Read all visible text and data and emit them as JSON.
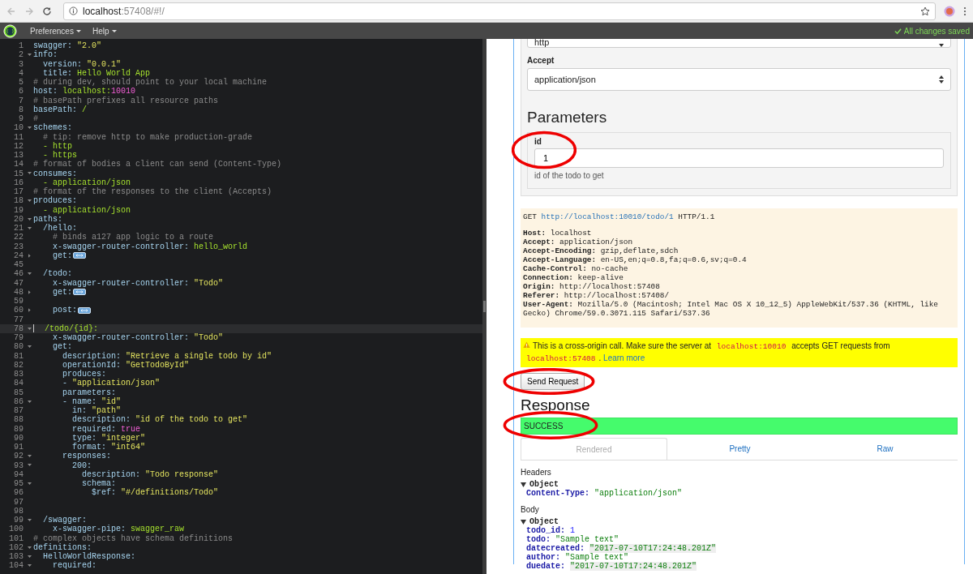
{
  "browser": {
    "url_host": "localhost",
    "url_rest": ":57408/#!/"
  },
  "menubar": {
    "menus": [
      {
        "label": "Preferences"
      },
      {
        "label": "Help"
      }
    ],
    "save_status": "All changes saved"
  },
  "editor": {
    "lines": [
      {
        "number": "1",
        "active": false,
        "segs": [
          {
            "kind": "key",
            "text": "swagger: "
          },
          {
            "kind": "str",
            "text": "\"2.0\""
          }
        ]
      },
      {
        "number": "2",
        "active": false,
        "expanded": true,
        "segs": [
          {
            "kind": "key",
            "text": "info:"
          }
        ]
      },
      {
        "number": "3",
        "active": false,
        "segs": [
          {
            "kind": "key",
            "text": "  version: "
          },
          {
            "kind": "str",
            "text": "\"0.0.1\""
          }
        ]
      },
      {
        "number": "4",
        "active": false,
        "segs": [
          {
            "kind": "key",
            "text": "  title: "
          },
          {
            "kind": "val",
            "text": "Hello World App"
          }
        ]
      },
      {
        "number": "5",
        "active": false,
        "segs": [
          {
            "kind": "comment",
            "text": "# during dev, should point to your local machine"
          }
        ]
      },
      {
        "number": "6",
        "active": false,
        "segs": [
          {
            "kind": "key",
            "text": "host: "
          },
          {
            "kind": "val",
            "text": "localhost:"
          },
          {
            "kind": "const",
            "text": "10010"
          }
        ]
      },
      {
        "number": "7",
        "active": false,
        "segs": [
          {
            "kind": "comment",
            "text": "# basePath prefixes all resource paths"
          }
        ]
      },
      {
        "number": "8",
        "active": false,
        "segs": [
          {
            "kind": "key",
            "text": "basePath: "
          },
          {
            "kind": "val",
            "text": "/"
          }
        ]
      },
      {
        "number": "9",
        "active": false,
        "segs": [
          {
            "kind": "comment",
            "text": "#"
          }
        ]
      },
      {
        "number": "10",
        "active": false,
        "expanded": true,
        "segs": [
          {
            "kind": "key",
            "text": "schemes:"
          }
        ]
      },
      {
        "number": "11",
        "active": false,
        "segs": [
          {
            "kind": "comment",
            "text": "  # tip: remove http to make production-grade"
          }
        ]
      },
      {
        "number": "12",
        "active": false,
        "segs": [
          {
            "kind": "val",
            "text": "  - http"
          }
        ]
      },
      {
        "number": "13",
        "active": false,
        "segs": [
          {
            "kind": "val",
            "text": "  - https"
          }
        ]
      },
      {
        "number": "14",
        "active": false,
        "segs": [
          {
            "kind": "comment",
            "text": "# format of bodies a client can send (Content-Type)"
          }
        ]
      },
      {
        "number": "15",
        "active": false,
        "expanded": true,
        "segs": [
          {
            "kind": "key",
            "text": "consumes:"
          }
        ]
      },
      {
        "number": "16",
        "active": false,
        "segs": [
          {
            "kind": "val",
            "text": "  - application/json"
          }
        ]
      },
      {
        "number": "17",
        "active": false,
        "segs": [
          {
            "kind": "comment",
            "text": "# format of the responses to the client (Accepts)"
          }
        ]
      },
      {
        "number": "18",
        "active": false,
        "expanded": true,
        "segs": [
          {
            "kind": "key",
            "text": "produces:"
          }
        ]
      },
      {
        "number": "19",
        "active": false,
        "segs": [
          {
            "kind": "val",
            "text": "  - application/json"
          }
        ]
      },
      {
        "number": "20",
        "active": false,
        "expanded": true,
        "segs": [
          {
            "kind": "key",
            "text": "paths:"
          }
        ]
      },
      {
        "number": "21",
        "active": false,
        "expanded": true,
        "segs": [
          {
            "kind": "key",
            "text": "  /hello:"
          }
        ]
      },
      {
        "number": "22",
        "active": false,
        "segs": [
          {
            "kind": "comment",
            "text": "    # binds a127 app logic to a route"
          }
        ]
      },
      {
        "number": "23",
        "active": false,
        "segs": [
          {
            "kind": "key",
            "text": "    x-swagger-router-controller: "
          },
          {
            "kind": "val",
            "text": "hello_world"
          }
        ]
      },
      {
        "number": "24",
        "active": false,
        "expanded": false,
        "segs": [
          {
            "kind": "key",
            "text": "    get:"
          }
        ]
      },
      {
        "number": "45",
        "active": false
      },
      {
        "number": "46",
        "active": false,
        "expanded": true,
        "segs": [
          {
            "kind": "key",
            "text": "  /todo:"
          }
        ]
      },
      {
        "number": "47",
        "active": false,
        "segs": [
          {
            "kind": "key",
            "text": "    x-swagger-router-controller: "
          },
          {
            "kind": "str",
            "text": "\"Todo\""
          }
        ]
      },
      {
        "number": "48",
        "active": false,
        "expanded": false,
        "segs": [
          {
            "kind": "key",
            "text": "    get:"
          }
        ]
      },
      {
        "number": "59",
        "active": false
      },
      {
        "number": "60",
        "active": false,
        "expanded": false,
        "segs": [
          {
            "kind": "key",
            "text": "    post:"
          }
        ]
      },
      {
        "number": "77",
        "active": false
      },
      {
        "number": "78",
        "active": true,
        "expanded": true,
        "segs": [
          {
            "kind": "val",
            "text": "  /todo/{id}:"
          }
        ]
      },
      {
        "number": "79",
        "active": false,
        "segs": [
          {
            "kind": "key",
            "text": "    x-swagger-router-controller: "
          },
          {
            "kind": "str",
            "text": "\"Todo\""
          }
        ]
      },
      {
        "number": "80",
        "active": false,
        "expanded": true,
        "segs": [
          {
            "kind": "key",
            "text": "    get:"
          }
        ]
      },
      {
        "number": "81",
        "active": false,
        "segs": [
          {
            "kind": "key",
            "text": "      description: "
          },
          {
            "kind": "str",
            "text": "\"Retrieve a single todo by id\""
          }
        ]
      },
      {
        "number": "82",
        "active": false,
        "segs": [
          {
            "kind": "key",
            "text": "      operationId: "
          },
          {
            "kind": "str",
            "text": "\"GetTodoById\""
          }
        ]
      },
      {
        "number": "83",
        "active": false,
        "segs": [
          {
            "kind": "key",
            "text": "      produces:"
          }
        ]
      },
      {
        "number": "84",
        "active": false,
        "segs": [
          {
            "kind": "key",
            "text": "      - "
          },
          {
            "kind": "str",
            "text": "\"application/json\""
          }
        ]
      },
      {
        "number": "85",
        "active": false,
        "segs": [
          {
            "kind": "key",
            "text": "      parameters:"
          }
        ]
      },
      {
        "number": "86",
        "active": false,
        "expanded": true,
        "segs": [
          {
            "kind": "key",
            "text": "      - name: "
          },
          {
            "kind": "str",
            "text": "\"id\""
          }
        ]
      },
      {
        "number": "87",
        "active": false,
        "segs": [
          {
            "kind": "key",
            "text": "        in: "
          },
          {
            "kind": "str",
            "text": "\"path\""
          }
        ]
      },
      {
        "number": "88",
        "active": false,
        "segs": [
          {
            "kind": "key",
            "text": "        description: "
          },
          {
            "kind": "str",
            "text": "\"id of the todo to get\""
          }
        ]
      },
      {
        "number": "89",
        "active": false,
        "segs": [
          {
            "kind": "key",
            "text": "        required: "
          },
          {
            "kind": "const",
            "text": "true"
          }
        ]
      },
      {
        "number": "90",
        "active": false,
        "segs": [
          {
            "kind": "key",
            "text": "        type: "
          },
          {
            "kind": "str",
            "text": "\"integer\""
          }
        ]
      },
      {
        "number": "91",
        "active": false,
        "segs": [
          {
            "kind": "key",
            "text": "        format: "
          },
          {
            "kind": "str",
            "text": "\"int64\""
          }
        ]
      },
      {
        "number": "92",
        "active": false,
        "expanded": true,
        "segs": [
          {
            "kind": "key",
            "text": "      responses:"
          }
        ]
      },
      {
        "number": "93",
        "active": false,
        "expanded": true,
        "segs": [
          {
            "kind": "key",
            "text": "        200:"
          }
        ]
      },
      {
        "number": "94",
        "active": false,
        "segs": [
          {
            "kind": "key",
            "text": "          description: "
          },
          {
            "kind": "str",
            "text": "\"Todo response\""
          }
        ]
      },
      {
        "number": "95",
        "active": false,
        "expanded": true,
        "segs": [
          {
            "kind": "key",
            "text": "          schema:"
          }
        ]
      },
      {
        "number": "96",
        "active": false,
        "segs": [
          {
            "kind": "key",
            "text": "            $ref: "
          },
          {
            "kind": "str",
            "text": "\"#/definitions/Todo\""
          }
        ]
      },
      {
        "number": "97",
        "active": false
      },
      {
        "number": "98",
        "active": false
      },
      {
        "number": "99",
        "active": false,
        "expanded": true,
        "segs": [
          {
            "kind": "key",
            "text": "  /swagger:"
          }
        ]
      },
      {
        "number": "100",
        "active": false,
        "segs": [
          {
            "kind": "key",
            "text": "    x-swagger-pipe: "
          },
          {
            "kind": "val",
            "text": "swagger_raw"
          }
        ]
      },
      {
        "number": "101",
        "active": false,
        "segs": [
          {
            "kind": "comment",
            "text": "# complex objects have schema definitions"
          }
        ]
      },
      {
        "number": "102",
        "active": false,
        "expanded": true,
        "segs": [
          {
            "kind": "key",
            "text": "definitions:"
          }
        ]
      },
      {
        "number": "103",
        "active": false,
        "expanded": true,
        "segs": [
          {
            "kind": "key",
            "text": "  HelloWorldResponse:"
          }
        ]
      },
      {
        "number": "104",
        "active": false,
        "expanded": true,
        "segs": [
          {
            "kind": "key",
            "text": "    required:"
          }
        ]
      }
    ]
  },
  "request_form": {
    "scheme_select": "http",
    "accept_label": "Accept",
    "accept_select": "application/json",
    "parameters_heading": "Parameters",
    "parameters": [
      {
        "name": "id",
        "value": "1",
        "description": "id of the todo to get",
        "annotated": true
      }
    ]
  },
  "request_preview": {
    "method": "GET",
    "url": "http://localhost:10010/todo/1",
    "protocol": "HTTP/1.1",
    "headers": [
      {
        "name": "Host:",
        "value": "localhost"
      },
      {
        "name": "Accept:",
        "value": "application/json"
      },
      {
        "name": "Accept-Encoding:",
        "value": "gzip,deflate,sdch"
      },
      {
        "name": "Accept-Language:",
        "value": "en-US,en;q=0.8,fa;q=0.6,sv;q=0.4"
      },
      {
        "name": "Cache-Control:",
        "value": "no-cache"
      },
      {
        "name": "Connection:",
        "value": "keep-alive"
      },
      {
        "name": "Origin:",
        "value": "http://localhost:57408"
      },
      {
        "name": "Referer:",
        "value": "http://localhost:57408/"
      },
      {
        "name": "User-Agent:",
        "value": "Mozilla/5.0 (Macintosh; Intel Mac OS X 10_12_5) AppleWebKit/537.36 (KHTML, like Gecko) Chrome/59.0.3071.115 Safari/537.36"
      }
    ]
  },
  "warning": {
    "segments": [
      {
        "kind": "text",
        "text": "This is a cross-origin call. Make sure the server at "
      },
      {
        "kind": "code",
        "text": "localhost:10010"
      },
      {
        "kind": "text",
        "text": " accepts GET requests from "
      },
      {
        "kind": "code",
        "text": "localhost:57408"
      },
      {
        "kind": "text",
        "text": ". "
      },
      {
        "kind": "link",
        "text": "Learn more"
      }
    ]
  },
  "send_button": {
    "label": "Send Request",
    "annotated": true
  },
  "response": {
    "heading": "Response",
    "status": {
      "text": "SUCCESS",
      "kind": "success",
      "annotated": true
    },
    "tabs": [
      {
        "label": "Rendered",
        "selected": true
      },
      {
        "label": "Pretty",
        "selected": false
      },
      {
        "label": "Raw",
        "selected": false
      }
    ],
    "headers_label": "Headers",
    "headers_tree": {
      "label": "Object",
      "expanded": true,
      "properties": [
        {
          "key": "Content-Type:",
          "value": "\"application/json\"",
          "kind": "string"
        }
      ]
    },
    "body_label": "Body",
    "body_tree": {
      "label": "Object",
      "expanded": true,
      "properties": [
        {
          "key": "todo_id:",
          "value": "1",
          "kind": "number"
        },
        {
          "key": "todo:",
          "value": "\"Sample text\"",
          "kind": "string"
        },
        {
          "key": "datecreated:",
          "value": "\"2017-07-10T17:24:48.201Z\"",
          "kind": "date"
        },
        {
          "key": "author:",
          "value": "\"Sample text\"",
          "kind": "string"
        },
        {
          "key": "duedate:",
          "value": "\"2017-07-10T17:24:48.201Z\"",
          "kind": "date"
        }
      ]
    }
  }
}
